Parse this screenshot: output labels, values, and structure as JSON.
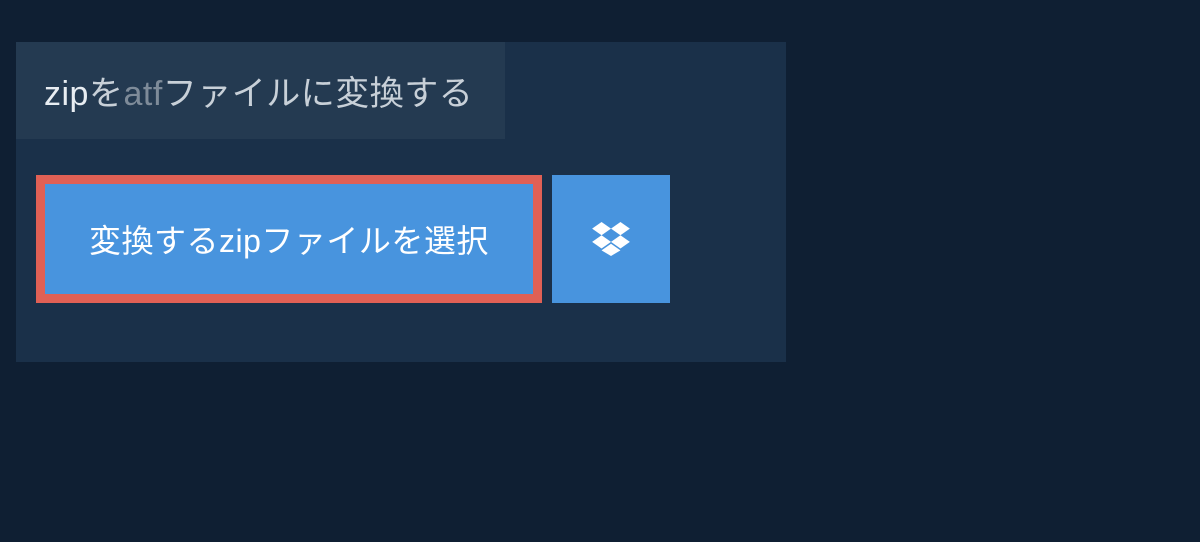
{
  "heading": {
    "zip": "zip",
    "wo": "を",
    "atf": "atf",
    "rest": "ファイルに変換する"
  },
  "buttons": {
    "select_label": "変換するzipファイルを選択"
  }
}
